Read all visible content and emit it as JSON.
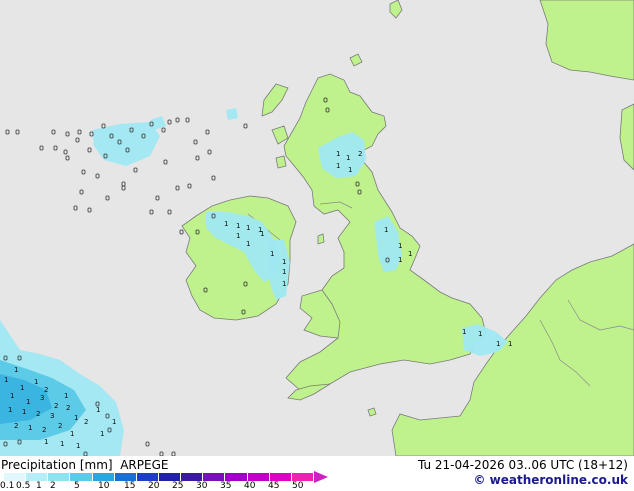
{
  "title": "Precipitation [mm]",
  "model": "ARPEGE",
  "datetime": "Tu 21-04-2026 03..06 UTC (18+12)",
  "credit": "© weatheronline.co.uk",
  "legend": {
    "ticks": [
      "0.1",
      "0.5",
      "1",
      "2",
      "5",
      "10",
      "15",
      "20",
      "25",
      "30",
      "35",
      "40",
      "45",
      "50"
    ],
    "colors": [
      "#e0f7fb",
      "#b6eef7",
      "#8de2f2",
      "#5ccbe8",
      "#2aa7dc",
      "#1a6fd0",
      "#1c3fc4",
      "#2222a8",
      "#3b1aa0",
      "#7a10b8",
      "#a000c8",
      "#c000c8",
      "#e000c0",
      "#f020b0"
    ]
  },
  "map_values": [
    "1",
    "1",
    "1",
    "1",
    "1",
    "1",
    "1",
    "1",
    "1",
    "1",
    "1",
    "1",
    "1",
    "2",
    "1",
    "1",
    "1",
    "1",
    "1",
    "1",
    "1",
    "1",
    "1",
    "1",
    "1",
    "1",
    "1",
    "1",
    "2",
    "1",
    "1",
    "3",
    "2",
    "1",
    "1",
    "1",
    "2",
    "3",
    "2",
    "1",
    "2",
    "1",
    "2",
    "2",
    "1",
    "2",
    "1",
    "1",
    "1",
    "1",
    "1",
    "1"
  ]
}
